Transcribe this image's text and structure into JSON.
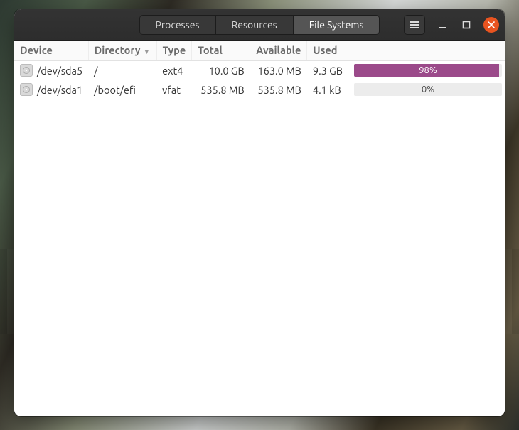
{
  "tabs": {
    "processes": "Processes",
    "resources": "Resources",
    "filesystems": "File Systems",
    "active": "filesystems"
  },
  "columns": {
    "device": "Device",
    "directory": "Directory",
    "type": "Type",
    "total": "Total",
    "available": "Available",
    "used": "Used",
    "sort_indicator": "▼"
  },
  "rows": [
    {
      "device": "/dev/sda5",
      "directory": "/",
      "type": "ext4",
      "total": "10.0 GB",
      "available": "163.0 MB",
      "used": "9.3 GB",
      "used_pct_label": "98%",
      "used_pct": 98
    },
    {
      "device": "/dev/sda1",
      "directory": "/boot/efi",
      "type": "vfat",
      "total": "535.8 MB",
      "available": "535.8 MB",
      "used": "4.1 kB",
      "used_pct_label": "0%",
      "used_pct": 0
    }
  ],
  "colors": {
    "bar_fill": "#9b4a8a",
    "close_btn": "#e95420"
  }
}
